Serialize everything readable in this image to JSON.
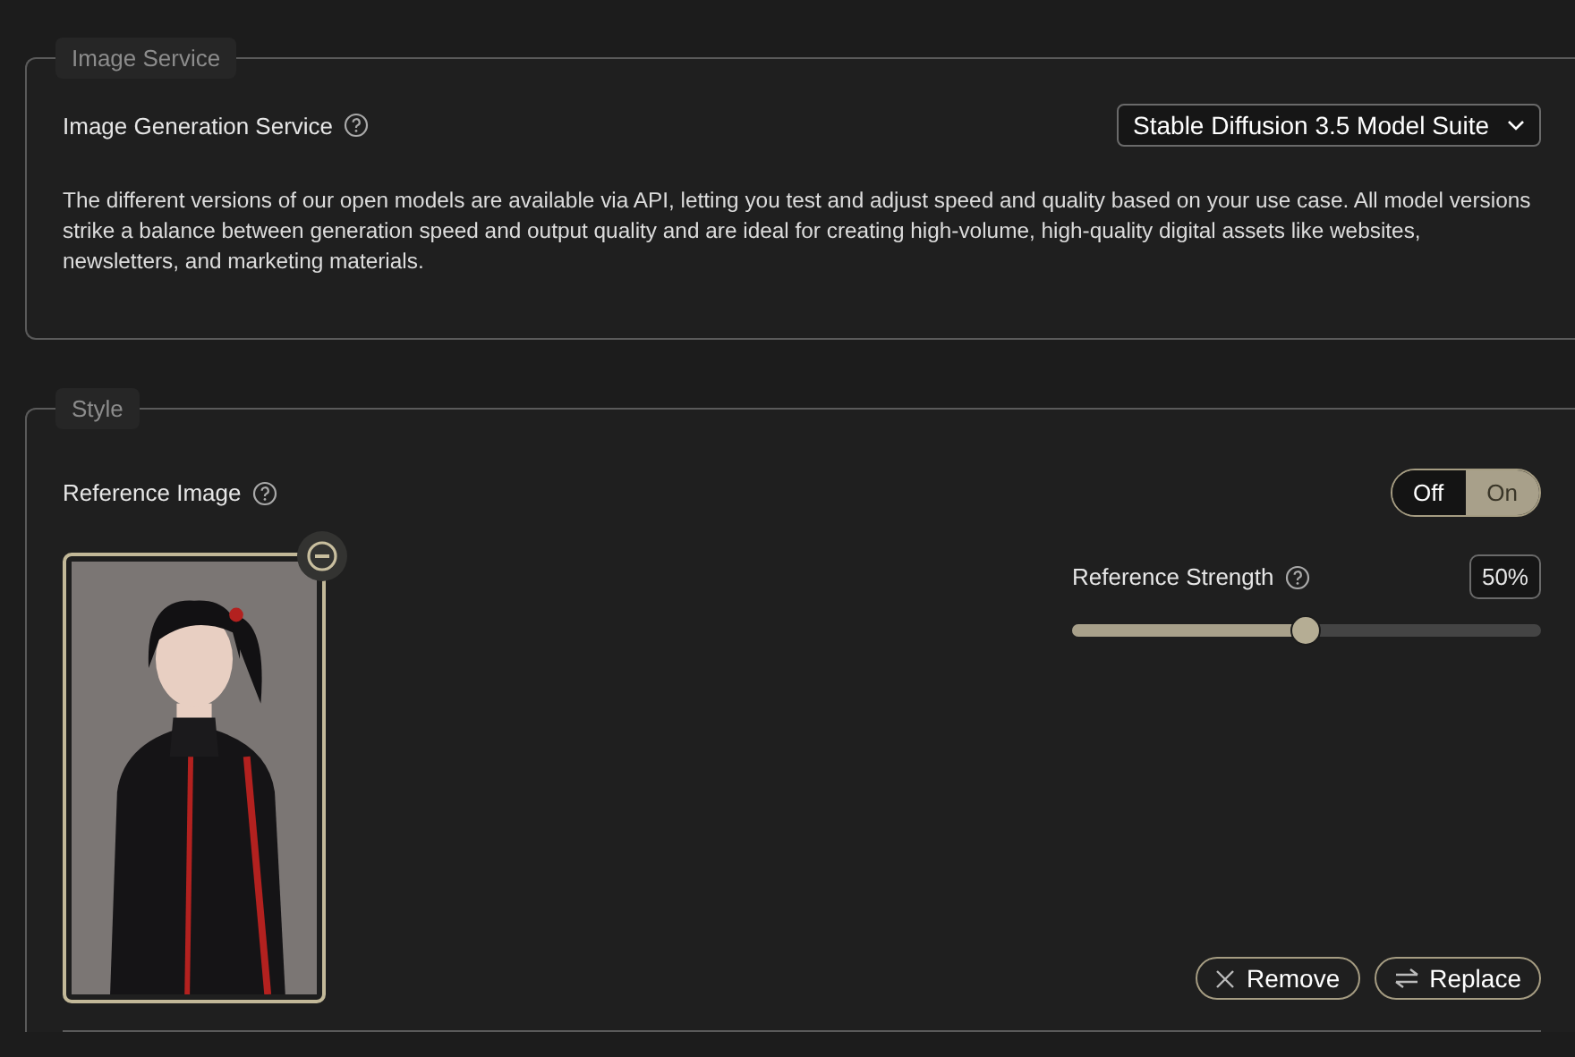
{
  "image_service": {
    "legend": "Image Service",
    "label": "Image Generation Service",
    "select": "Stable Diffusion 3.5 Model Suite",
    "description": "The different versions of our open models are available via API, letting you test and adjust speed and quality based on your use case. All model versions strike a balance between generation speed and output quality and are ideal for creating high-volume, high-quality digital assets like websites, newsletters, and marketing materials."
  },
  "style": {
    "legend": "Style",
    "label": "Reference Image",
    "toggle": [
      {
        "label": "Off",
        "selected": false
      },
      {
        "label": "On",
        "selected": true
      }
    ],
    "strength": {
      "label": "Reference Strength",
      "reading": "50%",
      "level": 0.5
    },
    "buttons": [
      {
        "kind": "remove",
        "label": "Remove"
      },
      {
        "kind": "replace",
        "label": "Replace"
      }
    ]
  }
}
